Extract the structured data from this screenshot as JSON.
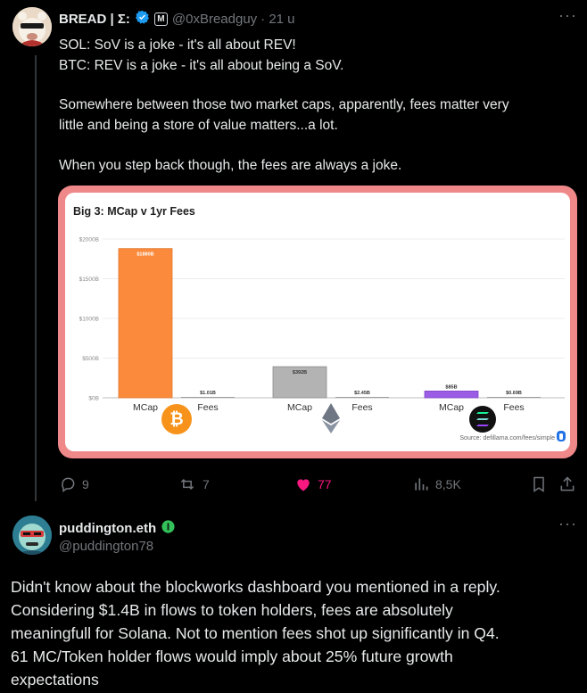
{
  "tweet": {
    "author_name": "BREAD | Σ:",
    "badge_letter": "M",
    "handle": "@0xBreadguy",
    "time": "· 21 u",
    "more": "···",
    "lines": [
      "SOL: SoV is a joke - it's all about REV!",
      "BTC: REV is a joke - it's all about being a SoV.",
      "Somewhere between those two market caps, apparently, fees matter very",
      "little and being a store of value matters...a lot.",
      "When you step back though, the fees are always a joke."
    ],
    "stats": {
      "replies": "9",
      "reposts": "7",
      "likes": "77",
      "views": "8,5K"
    },
    "colors": {
      "like": "#f91880",
      "verified": "#1d9bf0",
      "chart_frame": "#ef8889"
    },
    "icons": [
      "verified-icon",
      "reply-icon",
      "repost-icon",
      "heart-icon",
      "views-icon",
      "bookmark-icon",
      "share-icon"
    ]
  },
  "chart_data": {
    "type": "bar",
    "title": "Big 3: MCap v 1yr Fees",
    "source": "Source: defillama.com/fees/simple",
    "yticks": [
      "$2000B",
      "$1500B",
      "$1000B",
      "$500B",
      "$0B"
    ],
    "ylim": [
      0,
      2000
    ],
    "grid": true,
    "bar_colors": {
      "btc": "#fb8a3c",
      "eth": "#b3b3b3",
      "sol": "#9b5de5"
    },
    "groups": [
      {
        "asset": "BTC",
        "bars": [
          {
            "label": "MCap",
            "value": 1880,
            "data_label": "$1880B"
          },
          {
            "label": "Fees",
            "value": 1.01,
            "data_label": "$1.01B"
          }
        ]
      },
      {
        "asset": "ETH",
        "bars": [
          {
            "label": "MCap",
            "value": 392,
            "data_label": "$392B"
          },
          {
            "label": "Fees",
            "value": 2.45,
            "data_label": "$2.45B"
          }
        ]
      },
      {
        "asset": "SOL",
        "bars": [
          {
            "label": "MCap",
            "value": 85,
            "data_label": "$85B"
          },
          {
            "label": "Fees",
            "value": 0.69,
            "data_label": "$0.69B"
          }
        ]
      }
    ]
  },
  "reply": {
    "author_name": "puddington.eth",
    "handle": "@puddington78",
    "more": "···",
    "lines": [
      "Didn't know about the blockworks dashboard you mentioned in a reply.",
      "Considering $1.4B in flows to token holders, fees are absolutely",
      "meaningfull for Solana. Not to mention fees shot up significantly in Q4.",
      "61 MC/Token holder flows would imply about 25% future growth",
      "expectations"
    ]
  }
}
